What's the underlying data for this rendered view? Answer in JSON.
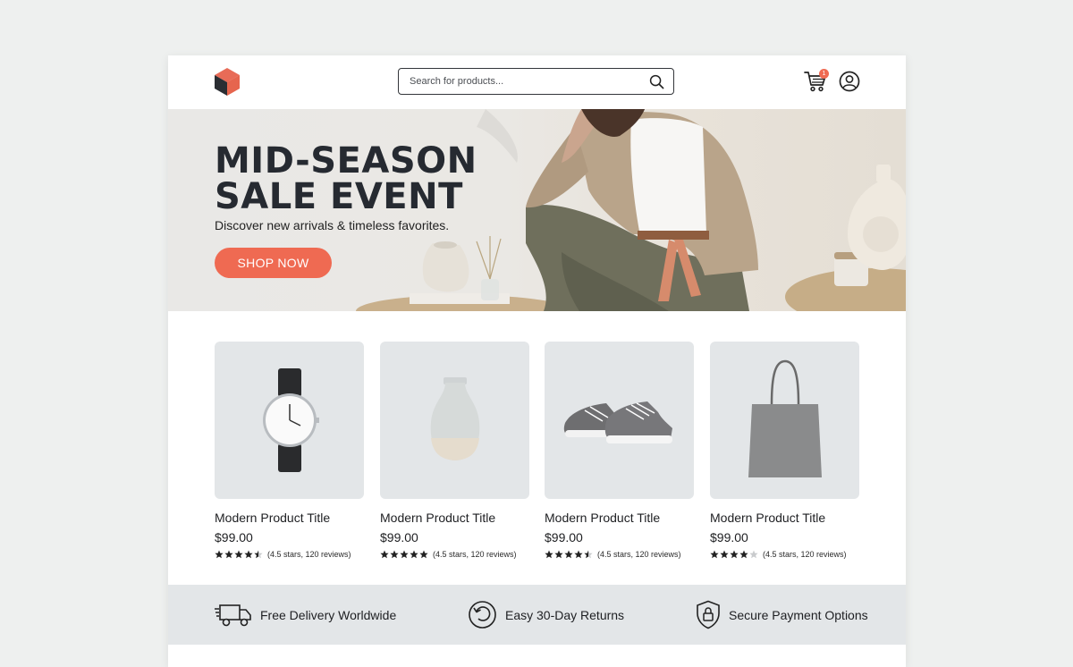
{
  "header": {
    "logo": "cube-logo",
    "search": {
      "placeholder": "Search for products...",
      "icon": "search-icon"
    },
    "cart": {
      "icon": "cart-icon",
      "badge": "1"
    },
    "account": {
      "icon": "user-circle-icon"
    }
  },
  "hero": {
    "title": "MID-SEASON SALE EVENT",
    "subtitle": "Discover new arrivals & timeless favorites.",
    "button_label": "SHOP NOW"
  },
  "products": [
    {
      "image": "wristwatch",
      "title": "Modern Product Title",
      "price": "$99.00",
      "rating": 4.5,
      "rating_text": "(4.5 stars, 120 reviews)"
    },
    {
      "image": "ceramic-vase",
      "title": "Modern Product Title",
      "price": "$99.00",
      "rating": 5,
      "rating_text": "(4.5 stars, 120 reviews)"
    },
    {
      "image": "sneakers",
      "title": "Modern Product Title",
      "price": "$99.00",
      "rating": 4.5,
      "rating_text": "(4.5 stars, 120 reviews)"
    },
    {
      "image": "tote-bag",
      "title": "Modern Product Title",
      "price": "$99.00",
      "rating": 4,
      "rating_text": "(4.5 stars, 120 reviews)"
    }
  ],
  "features": [
    {
      "icon": "truck-icon",
      "label": "Free Delivery Worldwide"
    },
    {
      "icon": "returns-icon",
      "label": "Easy 30-Day Returns"
    },
    {
      "icon": "shield-lock-icon",
      "label": "Secure Payment Options"
    }
  ],
  "colors": {
    "accent": "#ef6a52",
    "text": "#1e1f22",
    "feature_bar": "#e3e6e8",
    "product_bg": "#e3e6e8"
  }
}
